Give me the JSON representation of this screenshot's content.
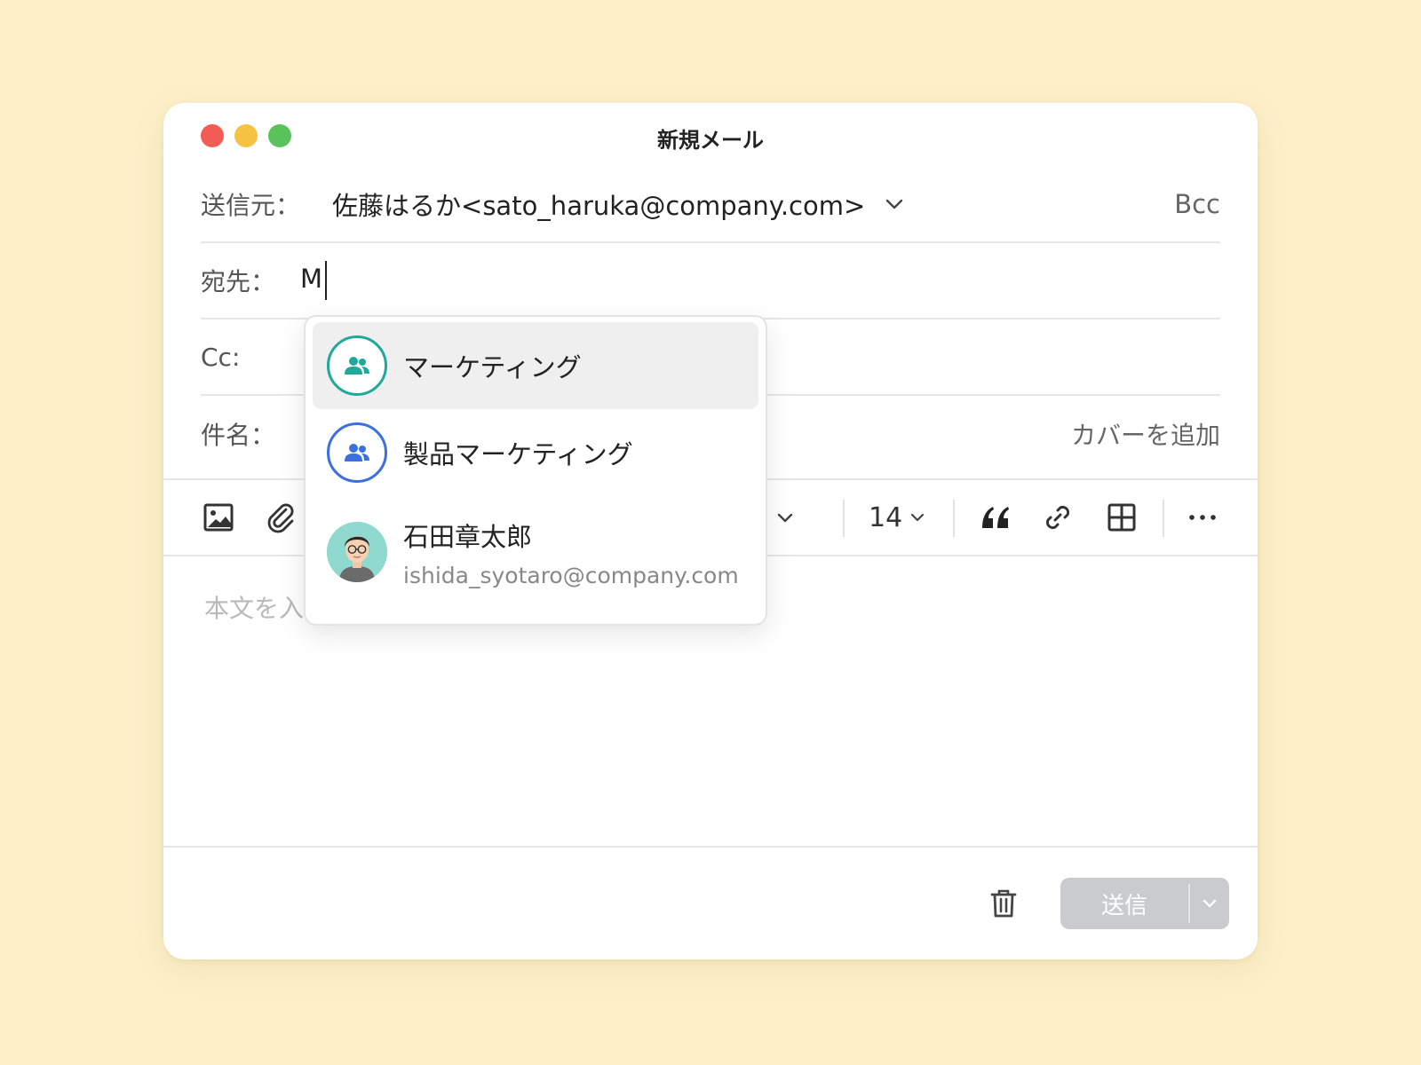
{
  "window": {
    "title": "新規メール"
  },
  "compose": {
    "from_label": "送信元：",
    "from_value": "佐藤はるか<sato_haruka@company.com>",
    "bcc_label": "Bcc",
    "to_label": "宛先：",
    "to_value": "M",
    "cc_label": "Cc:",
    "subject_label": "件名：",
    "add_cover_label": "カバーを追加",
    "body_placeholder": "本文を入"
  },
  "toolbar": {
    "font_size": "14",
    "icons": [
      "image-icon",
      "paperclip-icon",
      "chevron-down-icon",
      "quote-icon",
      "link-icon",
      "table-icon",
      "more-icon"
    ]
  },
  "suggestions": [
    {
      "label": "マーケティング",
      "type": "group",
      "accent": "#1fa99a",
      "active": true
    },
    {
      "label": "製品マーケティング",
      "type": "group",
      "accent": "#3c6fe0",
      "active": false
    },
    {
      "label": "石田章太郎",
      "sub": "ishida_syotaro@company.com",
      "type": "person",
      "active": false
    }
  ],
  "footer": {
    "send_label": "送信"
  },
  "colors": {
    "background": "#fdf0c9",
    "send_disabled": "#c9cbce",
    "group_teal": "#1fa99a",
    "group_blue": "#3c6fe0"
  }
}
